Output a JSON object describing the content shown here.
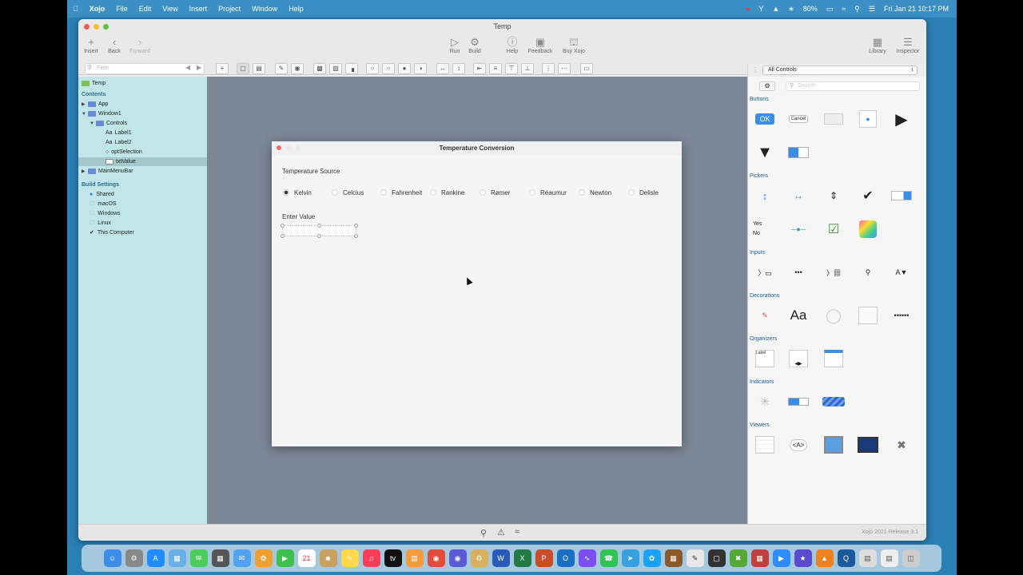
{
  "menubar": {
    "apple": "",
    "items": [
      "Xojo",
      "File",
      "Edit",
      "View",
      "Insert",
      "Project",
      "Window",
      "Help"
    ],
    "battery": "80%",
    "clock": "Fri Jan 21  10:17 PM"
  },
  "window": {
    "title": "Temp",
    "toolbar": {
      "insert": "Insert",
      "back": "Back",
      "forward": "Forward",
      "run": "Run",
      "build": "Build",
      "help": "Help",
      "feedback": "Feedback",
      "buy": "Buy Xojo",
      "library": "Library",
      "inspector": "Inspector"
    },
    "filter_placeholder": "Filter"
  },
  "navigator": {
    "project": "Temp",
    "contents_header": "Contents",
    "items": [
      "App",
      "Window1",
      "Controls",
      "Label1",
      "Label2",
      "optSelection",
      "txtValue",
      "MainMenuBar"
    ],
    "build_header": "Build Settings",
    "build_items": [
      "Shared",
      "macOS",
      "Windows",
      "Linux",
      "This Computer"
    ]
  },
  "design": {
    "title": "Temperature Conversion",
    "source_label": "Temperature Source",
    "options": [
      "Kelvin",
      "Celcius",
      "Fahrenheit",
      "Rankine",
      "Rømer",
      "Réaumur",
      "Newton",
      "Delisle"
    ],
    "selected_option": "Kelvin",
    "enter_label": "Enter Value"
  },
  "library": {
    "dropdown": "All Controls",
    "search_placeholder": "Search",
    "categories": [
      "Buttons",
      "Pickers",
      "Inputs",
      "Decorations",
      "Organizers",
      "Indicators",
      "Viewers"
    ],
    "ok": "OK",
    "cancel": "Cancel",
    "yes": "Yes",
    "no": "No",
    "text_aa": "Aa",
    "label_word": "Label",
    "html_tag": "<A>"
  },
  "status": {
    "release": "Xojo 2021 Release 3.1"
  }
}
